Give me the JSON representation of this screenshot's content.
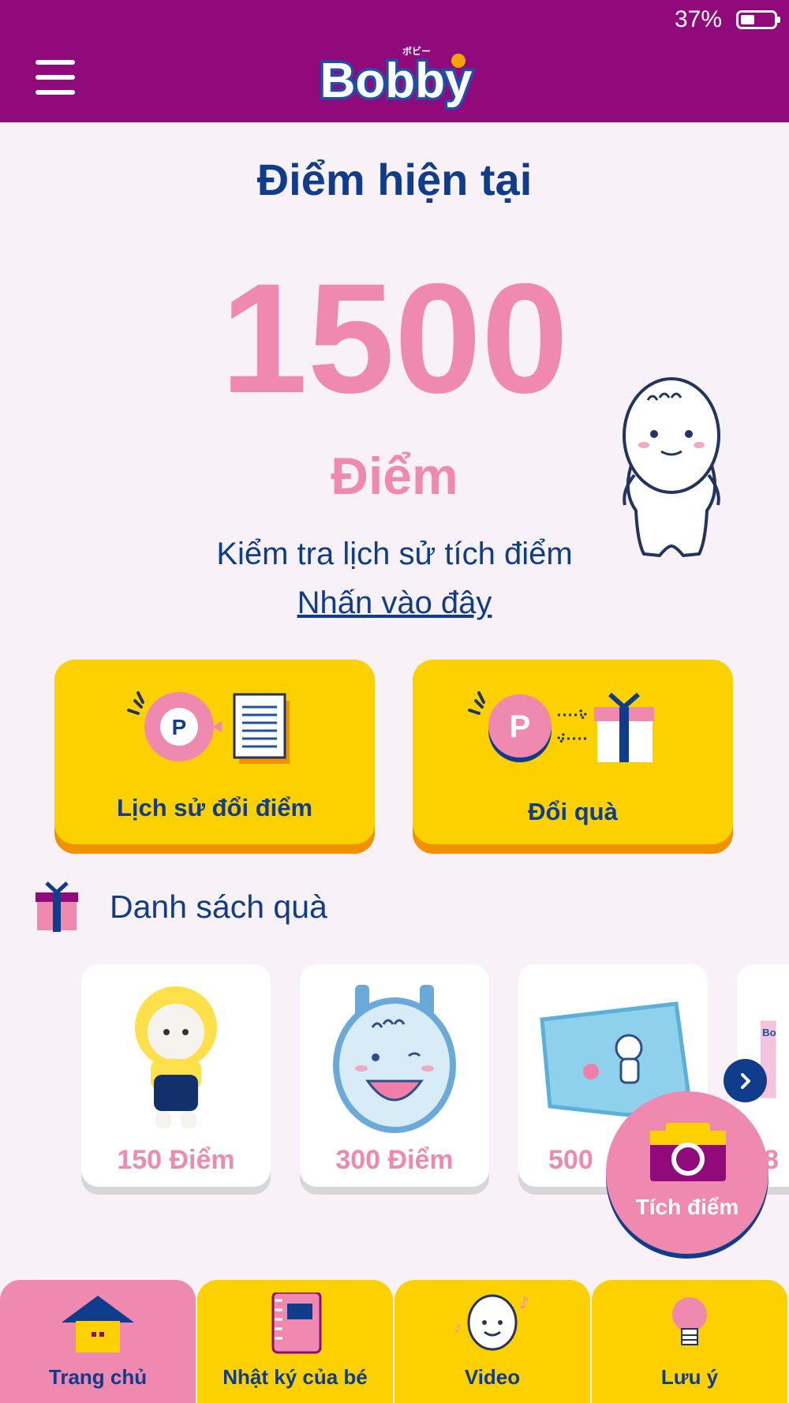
{
  "status_bar": {
    "battery": "37%"
  },
  "header": {
    "logo_text": "Bobby",
    "logo_kana": "ボビー"
  },
  "summary": {
    "title": "Điểm hiện tại",
    "points": "1500",
    "unit": "Điểm",
    "history_check_text": "Kiểm tra lịch sử tích điểm",
    "history_link": "Nhấn vào đây"
  },
  "actions": [
    {
      "label": "Lịch sử đổi điểm",
      "icon": "points-history-icon"
    },
    {
      "label": "Đổi quà",
      "icon": "points-exchange-gift-icon"
    }
  ],
  "gift_section": {
    "title": "Danh sách quà",
    "items": [
      {
        "label": "150 Điểm",
        "image": "plush-doll"
      },
      {
        "label": "300 Điểm",
        "image": "backpack"
      },
      {
        "label": "500",
        "image": "blanket"
      },
      {
        "label": "8",
        "image": "diaper-pack"
      }
    ]
  },
  "fab": {
    "label": "Tích điểm",
    "icon": "camera-icon"
  },
  "tabs": [
    {
      "label": "Trang chủ",
      "icon": "home-icon",
      "active": true
    },
    {
      "label": "Nhật ký của bé",
      "icon": "notebook-icon",
      "active": false
    },
    {
      "label": "Video",
      "icon": "video-mascot-icon",
      "active": false
    },
    {
      "label": "Lưu ý",
      "icon": "lightbulb-icon",
      "active": false
    }
  ],
  "colors": {
    "header": "#910a7b",
    "accent_pink": "#ef89b0",
    "navy": "#0f3d8c",
    "yellow": "#fdd000",
    "orange": "#f29100",
    "background": "#f8f1f8"
  }
}
